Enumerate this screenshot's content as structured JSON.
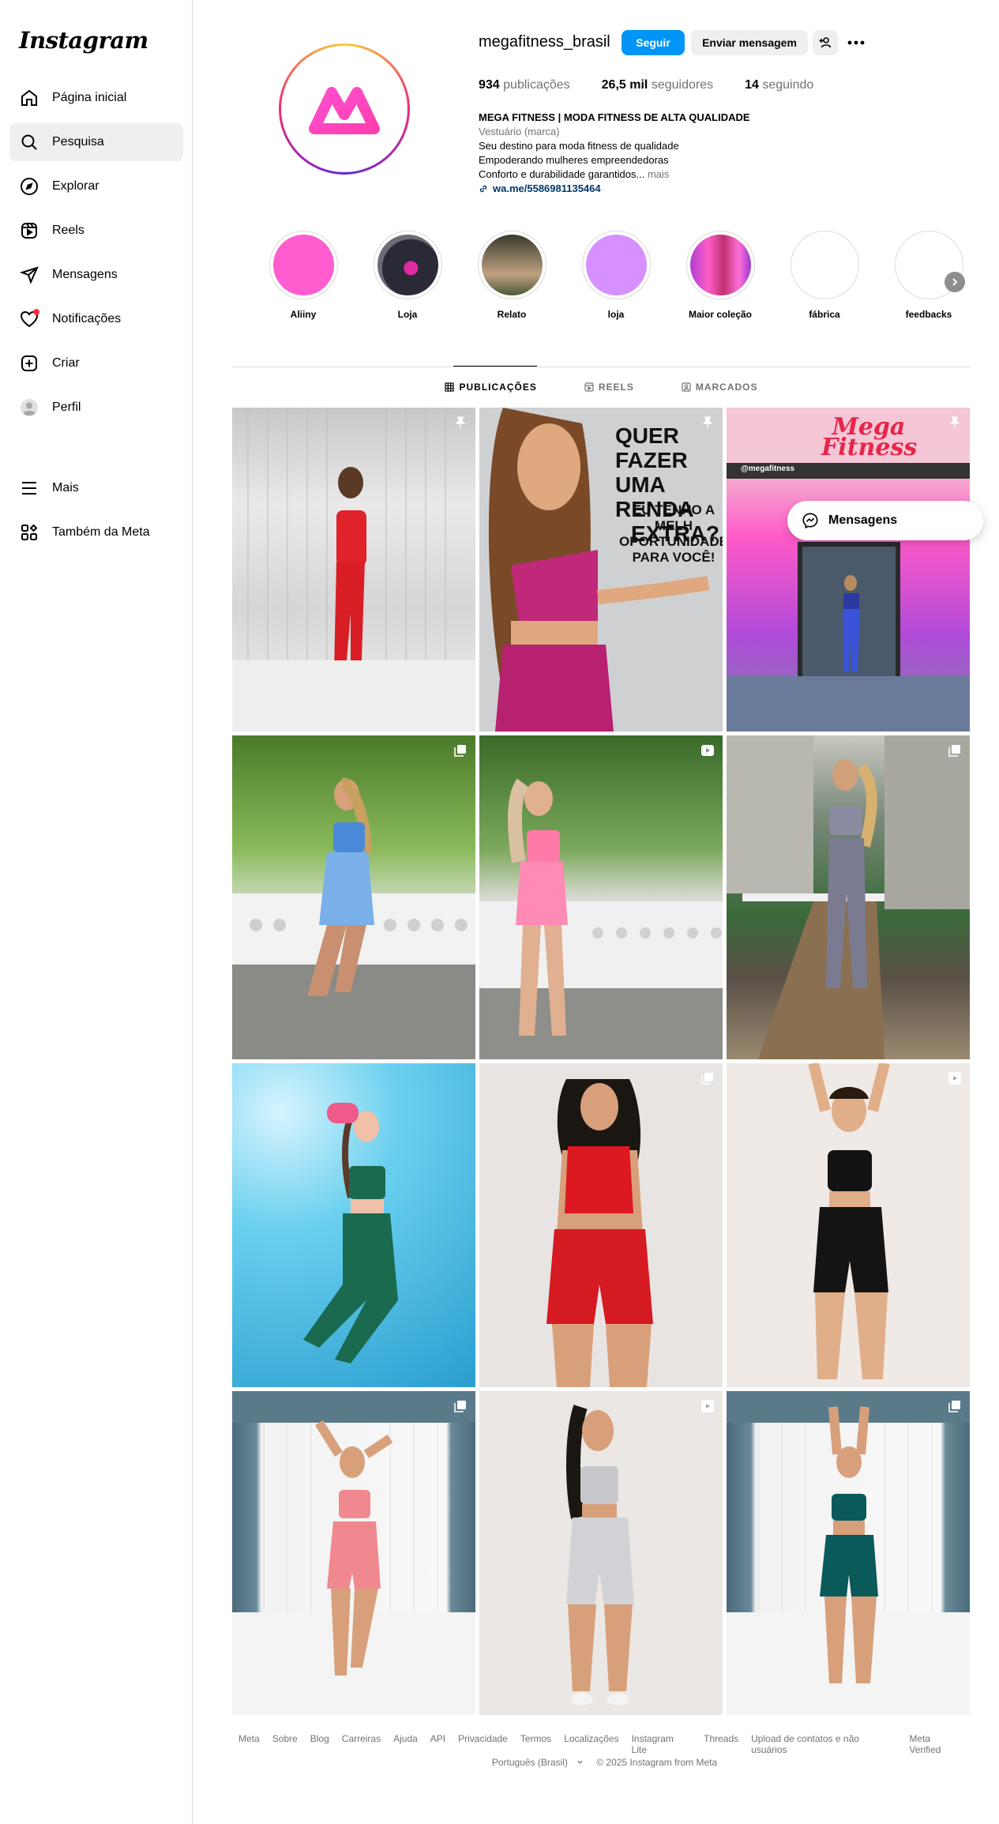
{
  "app": {
    "logo_text": "Instagram"
  },
  "sidebar": {
    "items": [
      {
        "label": "Página inicial",
        "icon": "home-icon"
      },
      {
        "label": "Pesquisa",
        "icon": "search-icon"
      },
      {
        "label": "Explorar",
        "icon": "compass-icon"
      },
      {
        "label": "Reels",
        "icon": "reels-icon"
      },
      {
        "label": "Mensagens",
        "icon": "send-icon"
      },
      {
        "label": "Notificações",
        "icon": "heart-icon"
      },
      {
        "label": "Criar",
        "icon": "plus-square-icon"
      },
      {
        "label": "Perfil",
        "icon": "avatar-icon"
      }
    ],
    "bottom_items": [
      {
        "label": "Mais",
        "icon": "menu-icon"
      },
      {
        "label": "Também da Meta",
        "icon": "meta-apps-icon"
      }
    ]
  },
  "profile": {
    "username": "megafitness_brasil",
    "follow_label": "Seguir",
    "message_label": "Enviar mensagem",
    "stats": {
      "posts_value": "934",
      "posts_label": "publicações",
      "followers_value": "26,5 mil",
      "followers_label": "seguidores",
      "following_value": "14",
      "following_label": "seguindo"
    },
    "bio": {
      "name": "MEGA FITNESS | MODA FITNESS DE ALTA QUALIDADE",
      "category": "Vestuário (marca)",
      "line1": "Seu destino para moda fitness de qualidade",
      "line2": "Empoderando mulheres empreendedoras",
      "line3": "Conforto e durabilidade garantidos...",
      "more": "mais",
      "link": "wa.me/5586981135464"
    }
  },
  "highlights": [
    {
      "label": "Aliiny"
    },
    {
      "label": "Loja"
    },
    {
      "label": "Relato"
    },
    {
      "label": "loja"
    },
    {
      "label": "Maior coleção"
    },
    {
      "label": "fábrica"
    },
    {
      "label": "feedbacks"
    }
  ],
  "tabs": [
    {
      "label": "PUBLICAÇÕES"
    },
    {
      "label": "REELS"
    },
    {
      "label": "MARCADOS"
    }
  ],
  "posts": {
    "p2_text1": "QUER FAZER",
    "p2_text2": "UMA RENDA",
    "p2_text3": "EXTRA?",
    "p2_text4": "EU TENHO A MELH",
    "p2_text5": "OPORTUNIDADE",
    "p2_text6": "PARA VOCÊ!",
    "p3_sign1": "Mega",
    "p3_sign2": "Fitness",
    "p3_handle": "@megafitness"
  },
  "floating_messages": {
    "label": "Mensagens"
  },
  "footer": {
    "links": [
      "Meta",
      "Sobre",
      "Blog",
      "Carreiras",
      "Ajuda",
      "API",
      "Privacidade",
      "Termos",
      "Localizações",
      "Instagram Lite",
      "Threads",
      "Upload de contatos e não usuários",
      "Meta Verified"
    ],
    "language": "Português (Brasil)",
    "copyright": "© 2025 Instagram from Meta"
  }
}
